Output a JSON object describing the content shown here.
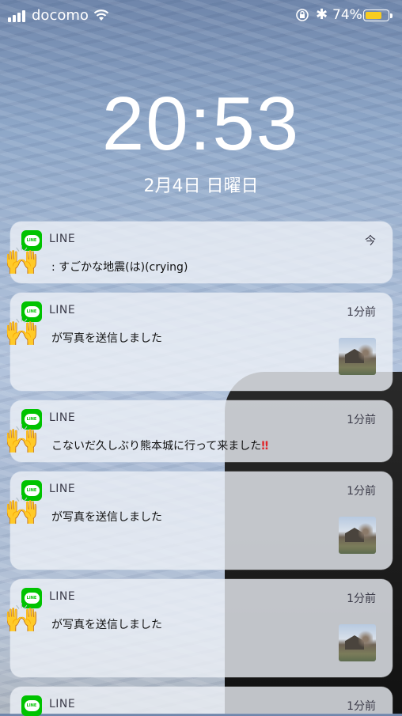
{
  "status_bar": {
    "carrier": "docomo",
    "battery_percent": "74%",
    "battery_level": 0.74,
    "battery_color": "#f7cc22"
  },
  "lock_screen": {
    "time": "20:53",
    "date": "2月4日 日曜日"
  },
  "notifications": [
    {
      "app": "LINE",
      "time": "今",
      "message": ": すごかな地震(は)(crying)",
      "has_thumbnail": false
    },
    {
      "app": "LINE",
      "time": "1分前",
      "message": "が写真を送信しました",
      "has_thumbnail": true
    },
    {
      "app": "LINE",
      "time": "1分前",
      "message": "こないだ久しぶり熊本城に行って来ました",
      "suffix": "‼",
      "has_thumbnail": false
    },
    {
      "app": "LINE",
      "time": "1分前",
      "message": "が写真を送信しました",
      "has_thumbnail": true
    },
    {
      "app": "LINE",
      "time": "1分前",
      "message": "が写真を送信しました",
      "has_thumbnail": true
    },
    {
      "app": "LINE",
      "time": "1分前",
      "message": "",
      "has_thumbnail": false
    }
  ],
  "icons": {
    "app_icon": "line-app-icon",
    "redaction": "raising-hands-emoji"
  }
}
